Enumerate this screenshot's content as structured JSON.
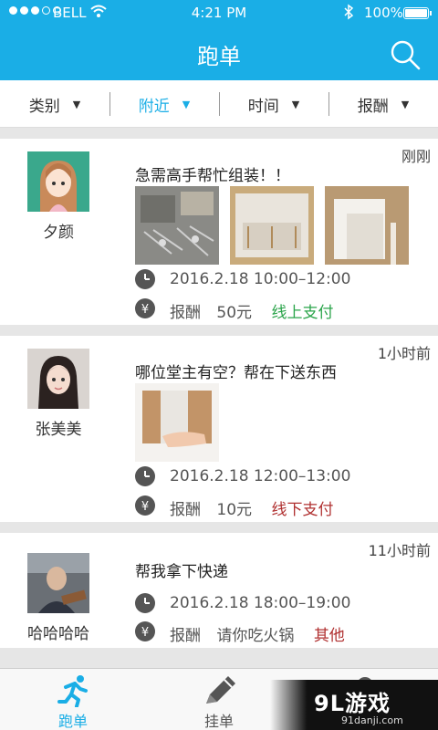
{
  "status_bar": {
    "carrier": "BELL",
    "time": "4:21 PM",
    "battery": "100%",
    "battery_level": 1.0,
    "signal_bars": 3
  },
  "nav": {
    "title": "跑单",
    "search_icon": "search-icon"
  },
  "filters": [
    {
      "label": "类别",
      "active": false
    },
    {
      "label": "附近",
      "active": true
    },
    {
      "label": "时间",
      "active": false
    },
    {
      "label": "报酬",
      "active": false
    }
  ],
  "colors": {
    "brand": "#1aaee6",
    "online_pay": "#2aa44a",
    "offline_pay": "#b03030"
  },
  "tasks": [
    {
      "user": "夕颜",
      "time_ago": "刚刚",
      "title": "急需高手帮忙组装！！",
      "schedule": "2016.2.18 10:00–12:00",
      "reward_label": "报酬",
      "reward": "50元",
      "payment": "线上支付"
    },
    {
      "user": "张美美",
      "time_ago": "1小时前",
      "title": "哪位堂主有空？帮在下送东西",
      "schedule": "2016.2.18 12:00–13:00",
      "reward_label": "报酬",
      "reward": "10元",
      "payment": "线下支付"
    },
    {
      "user": "哈哈哈哈",
      "time_ago": "11小时前",
      "title": "帮我拿下快递",
      "schedule": "2016.2.18 18:00–19:00",
      "reward_label": "报酬",
      "reward": "请你吃火锅",
      "payment": "其他"
    }
  ],
  "tabbar": [
    {
      "label": "跑单",
      "icon": "runner-icon",
      "active": true
    },
    {
      "label": "挂单",
      "icon": "pencil-icon",
      "active": false
    },
    {
      "label": "",
      "icon": "profile-icon",
      "active": false
    }
  ],
  "watermark": {
    "brand": "9L游戏",
    "site": "91danji.com"
  }
}
